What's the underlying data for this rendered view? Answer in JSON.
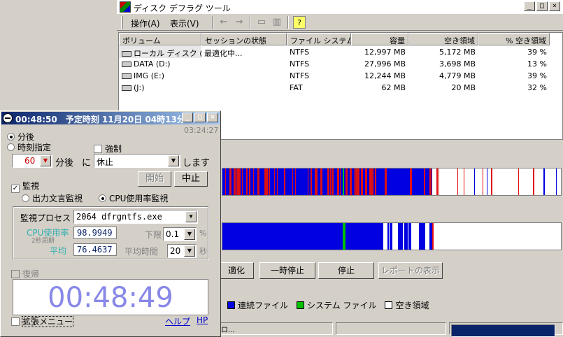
{
  "defrag": {
    "title": "ディスク デフラグ ツール",
    "menu": [
      "操作(A)",
      "表示(V)"
    ],
    "toolbar": {
      "back": "←",
      "forward": "→",
      "help": "?"
    },
    "columns": [
      "ボリューム",
      "セッションの状態",
      "ファイル システム",
      "容量",
      "空き領域",
      "% 空き領域"
    ],
    "rows": [
      {
        "volume": "ローカル ディスク (C:)",
        "status": "最適化中...",
        "fs": "NTFS",
        "capacity": "12,997 MB",
        "free": "5,172 MB",
        "pct": "39 %"
      },
      {
        "volume": "DATA (D:)",
        "status": "",
        "fs": "NTFS",
        "capacity": "27,996 MB",
        "free": "3,698 MB",
        "pct": "13 %"
      },
      {
        "volume": "IMG (E:)",
        "status": "",
        "fs": "NTFS",
        "capacity": "12,244 MB",
        "free": "4,779 MB",
        "pct": "39 %"
      },
      {
        "volume": "(J:)",
        "status": "",
        "fs": "FAT",
        "capacity": "62 MB",
        "free": "20 MB",
        "pct": "32 %"
      }
    ],
    "buttons": {
      "analyze": "適化",
      "pause": "一時停止",
      "stop": "停止",
      "report": "レポートの表示"
    },
    "legend": {
      "contiguous": "連続ファイル",
      "system": "システム ファイル",
      "free": "空き領域"
    },
    "colors": {
      "fragmented": "#e01010",
      "contiguous": "#0000e0",
      "system": "#00c000",
      "free": "#ffffff"
    },
    "status_text": "ロ...",
    "progress": 0.95
  },
  "timer": {
    "title": "00:48:50　予定時刻 11月20日 04時13分",
    "elapsed": "03:24:27",
    "mode_minutes": "分後",
    "mode_time": "時刻指定",
    "force": "強制",
    "minutes_value": "60",
    "minutes_suffix": "分後",
    "ni": "に",
    "action": "休止",
    "shimasu": "します",
    "start_button": "開始",
    "stop_button": "中止",
    "monitor": "監視",
    "monitor_output": "出力文言監視",
    "monitor_cpu": "CPU使用率監視",
    "process_label": "監視プロセス",
    "process_value": "2064 dfrgntfs.exe",
    "cpu_label": "CPU使用率",
    "cpu_sub": "2秒周期",
    "cpu_value": "98.9949",
    "avg_label": "平均",
    "avg_value": "76.4637",
    "lower_label": "下限",
    "lower_value": "0.1",
    "lower_unit": "%",
    "avg_time_label": "平均時間",
    "avg_time_value": "20",
    "avg_time_unit": "秒",
    "restore": "復帰",
    "clock": "00:48:49",
    "ext_menu": "拡張メニュー",
    "help": "ヘルプ",
    "hp": "HP"
  }
}
